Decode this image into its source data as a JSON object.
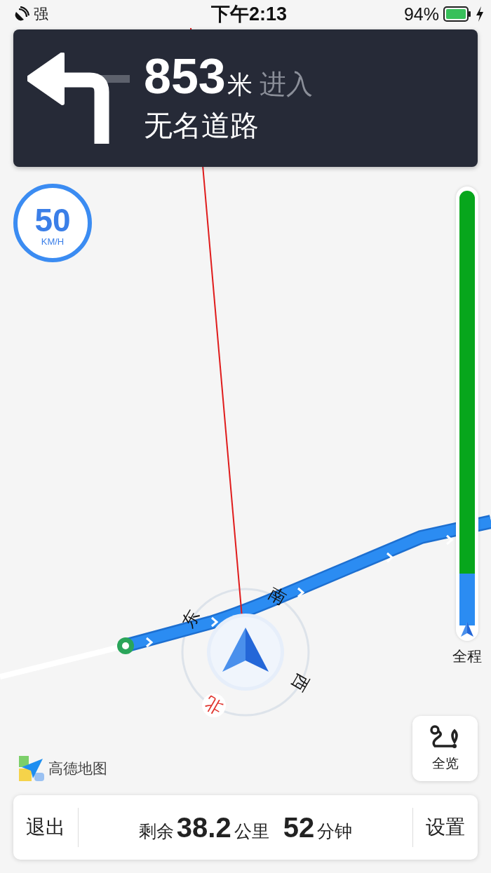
{
  "status_bar": {
    "signal": "强",
    "time": "下午2:13",
    "battery": "94%"
  },
  "turn": {
    "distance": "853",
    "unit": "米",
    "action": "进入",
    "road": "无名道路"
  },
  "speed_limit": {
    "value": "50",
    "unit": "KM/H"
  },
  "compass": [
    {
      "kind": "east",
      "label": "东"
    },
    {
      "kind": "south",
      "label": "南"
    },
    {
      "kind": "west",
      "label": "西"
    },
    {
      "kind": "north",
      "label": "北"
    }
  ],
  "progress": {
    "level": 0.12,
    "label": "全程"
  },
  "overview_button": {
    "label": "全览"
  },
  "logo": {
    "label": "高德地图"
  },
  "bottom_bar": {
    "exit": "退出",
    "remaining_label": "剩余",
    "distance": "38.2",
    "distance_unit": "公里",
    "time": "52",
    "time_unit": "分钟",
    "settings": "设置"
  }
}
